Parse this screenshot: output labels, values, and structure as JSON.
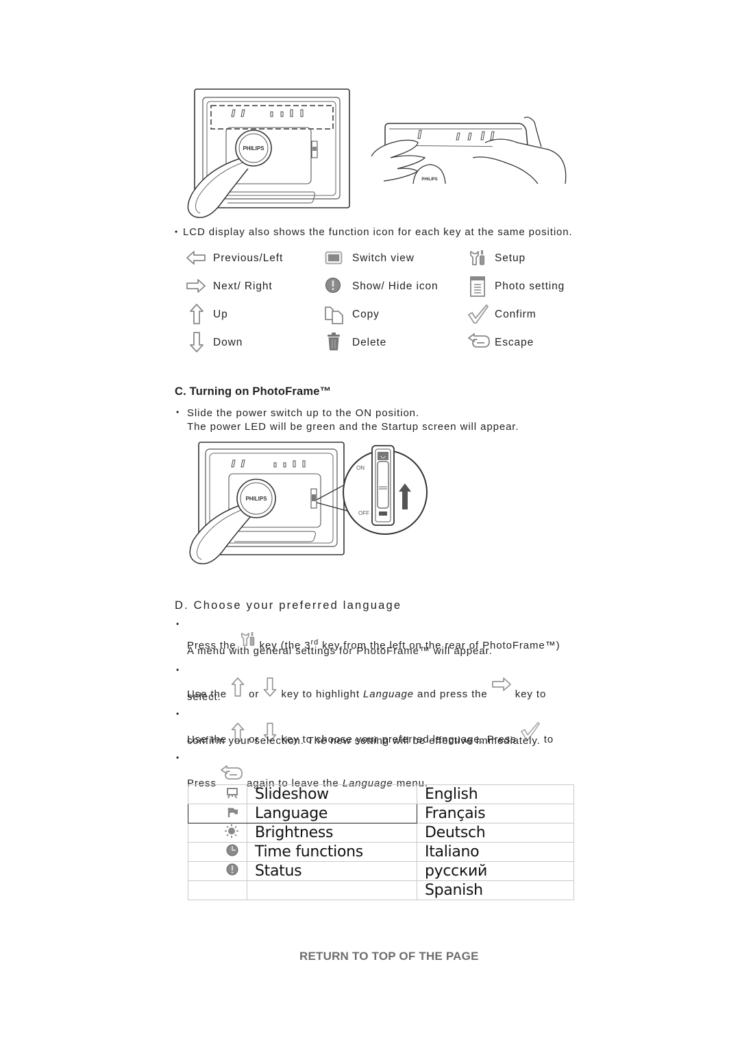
{
  "figures": {
    "frame_back": {
      "brand": "PHILIPS"
    },
    "frame_hands": {
      "brand": "PHILIPS"
    },
    "frame_power": {
      "brand": "PHILIPS",
      "switch_on_label": "ON",
      "switch_off_label": "OFF"
    }
  },
  "intro": {
    "bullet": "•",
    "text": "LCD display also shows the function icon for each key at the same position."
  },
  "key_icons": [
    {
      "icon": "arrow-left-icon",
      "label": "Previous/Left"
    },
    {
      "icon": "switch-view-icon",
      "label": "Switch view"
    },
    {
      "icon": "setup-icon",
      "label": "Setup"
    },
    {
      "icon": "arrow-right-icon",
      "label": "Next/ Right"
    },
    {
      "icon": "info-icon",
      "label": "Show/ Hide icon"
    },
    {
      "icon": "photo-setting-icon",
      "label": "Photo setting"
    },
    {
      "icon": "arrow-up-icon",
      "label": "Up"
    },
    {
      "icon": "copy-icon",
      "label": "Copy"
    },
    {
      "icon": "checkmark-icon",
      "label": "Confirm"
    },
    {
      "icon": "arrow-down-icon",
      "label": "Down"
    },
    {
      "icon": "trash-icon",
      "label": "Delete"
    },
    {
      "icon": "escape-icon",
      "label": "Escape"
    }
  ],
  "section_c": {
    "title": "C. Turning on PhotoFrame™",
    "bullet": "•",
    "line1": "Slide the power switch up to the ON position.",
    "line2": "The power LED will be green and the Startup screen will appear."
  },
  "section_d": {
    "title": "D. Choose your preferred language",
    "steps": [
      {
        "bullet": "•",
        "t1": "Press the",
        "t2": "key (the 3",
        "sup": "rd",
        "t3": "key from the left on the rear of PhotoFrame™)",
        "line2": "A menu with general settings for PhotoFrame™ will appear."
      },
      {
        "bullet": "•",
        "t1": "Use the",
        "t2": "or",
        "t3": "key to highlight",
        "em": "Language",
        "t4": "and press the",
        "t5": "key to",
        "line2": "select."
      },
      {
        "bullet": "•",
        "t1": "Use the",
        "t2": "or",
        "t3": "key to choose your preferred language. Press",
        "t4": "to",
        "line2": "confirm your selection. The new setting will be effective immediately."
      },
      {
        "bullet": "•",
        "t1": "Press",
        "t2": "again to leave the",
        "em": "Language",
        "t3": "menu."
      }
    ]
  },
  "menu_table": {
    "rows": [
      {
        "icon": "slideshow-icon",
        "label": "Slideshow",
        "language": "English",
        "selected": false
      },
      {
        "icon": "flag-icon",
        "label": "Language",
        "language": "Français",
        "selected": true
      },
      {
        "icon": "brightness-icon",
        "label": "Brightness",
        "language": "Deutsch",
        "selected": false
      },
      {
        "icon": "clock-icon",
        "label": "Time functions",
        "language": "Italiano",
        "selected": false
      },
      {
        "icon": "status-icon",
        "label": "Status",
        "language": "русский",
        "selected": false
      },
      {
        "icon": "",
        "label": "",
        "language": "Spanish",
        "selected": false
      }
    ]
  },
  "footer": {
    "return_link": "RETURN TO TOP OF THE PAGE",
    "link_color": "#6d6d6d"
  }
}
